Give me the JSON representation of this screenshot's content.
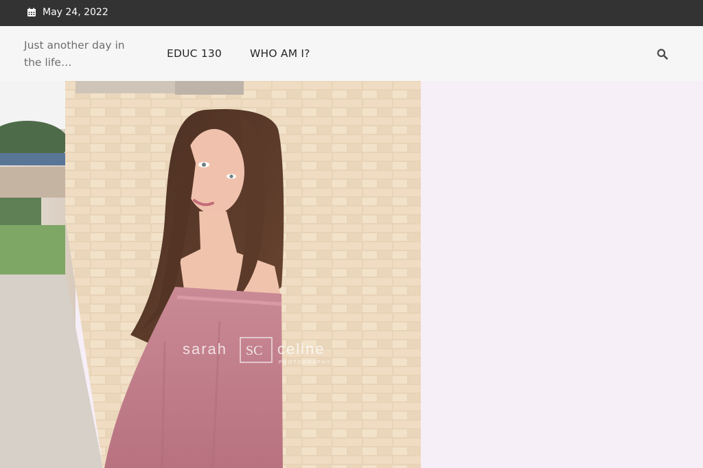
{
  "topbar": {
    "date": "May 24, 2022",
    "icon": "calendar-icon"
  },
  "header": {
    "tagline": "Just another day in the life…",
    "menu": [
      {
        "label": "EDUC 130"
      },
      {
        "label": "WHO AM I?"
      }
    ],
    "search_icon": "search-icon"
  },
  "hero": {
    "watermark_logo_text": "sarah SC celine PHOTOGRAPHY"
  },
  "colors": {
    "topbar_bg": "#333333",
    "navbar_bg": "#f6f6f6",
    "panel_bg": "#f7eff7",
    "menu_text": "#262626",
    "tagline_text": "#6d6d6d"
  }
}
